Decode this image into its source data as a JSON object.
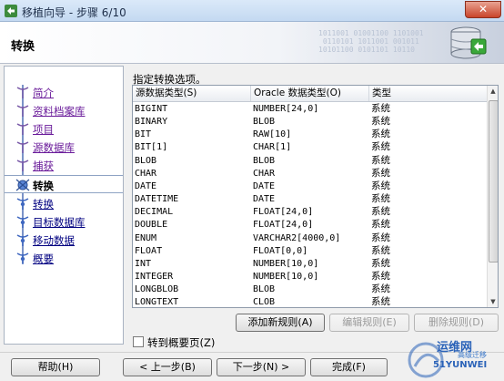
{
  "window": {
    "title": "移植向导 - 步骤 6/10",
    "close_label": "✕"
  },
  "header": {
    "title": "转换",
    "binary_text": "1011001 01001100 1101001\n 0110101 1011001 001011\n10101100 0101101 10110"
  },
  "nav": {
    "items": [
      {
        "label": "简介",
        "state": "done"
      },
      {
        "label": "资料档案库",
        "state": "done"
      },
      {
        "label": "项目",
        "state": "done"
      },
      {
        "label": "源数据库",
        "state": "done"
      },
      {
        "label": "捕获",
        "state": "done"
      },
      {
        "label": "转换",
        "state": "active"
      },
      {
        "label": "转换",
        "state": "todo"
      },
      {
        "label": "目标数据库",
        "state": "todo"
      },
      {
        "label": "移动数据",
        "state": "todo"
      },
      {
        "label": "概要",
        "state": "todo"
      }
    ]
  },
  "content": {
    "label": "指定转换选项。",
    "table": {
      "headers": [
        "源数据类型(S)",
        "Oracle 数据类型(O)",
        "类型"
      ],
      "rows": [
        [
          "BIGINT",
          "NUMBER[24,0]",
          "系统"
        ],
        [
          "BINARY",
          "BLOB",
          "系统"
        ],
        [
          "BIT",
          "RAW[10]",
          "系统"
        ],
        [
          "BIT[1]",
          "CHAR[1]",
          "系统"
        ],
        [
          "BLOB",
          "BLOB",
          "系统"
        ],
        [
          "CHAR",
          "CHAR",
          "系统"
        ],
        [
          "DATE",
          "DATE",
          "系统"
        ],
        [
          "DATETIME",
          "DATE",
          "系统"
        ],
        [
          "DECIMAL",
          "FLOAT[24,0]",
          "系统"
        ],
        [
          "DOUBLE",
          "FLOAT[24,0]",
          "系统"
        ],
        [
          "ENUM",
          "VARCHAR2[4000,0]",
          "系统"
        ],
        [
          "FLOAT",
          "FLOAT[0,0]",
          "系统"
        ],
        [
          "INT",
          "NUMBER[10,0]",
          "系统"
        ],
        [
          "INTEGER",
          "NUMBER[10,0]",
          "系统"
        ],
        [
          "LONGBLOB",
          "BLOB",
          "系统"
        ],
        [
          "LONGTEXT",
          "CLOB",
          "系统"
        ]
      ]
    },
    "buttons": {
      "add_rule": "添加新规则(A)",
      "edit_rule": "编辑规则(E)",
      "delete_rule": "删除规则(D)"
    },
    "checkbox_label": "转到概要页(Z)"
  },
  "footer": {
    "help": "帮助(H)",
    "back": "< 上一步(B)",
    "next": "下一步(N) >",
    "finish": "完成(F)"
  },
  "watermark": {
    "text1": "运维网",
    "text2": "高级迁移",
    "text3": "51YUNWEI"
  },
  "colors": {
    "link_done": "#6a1b9a",
    "link_todo": "#000080",
    "nav_track": "#7b93c8"
  }
}
